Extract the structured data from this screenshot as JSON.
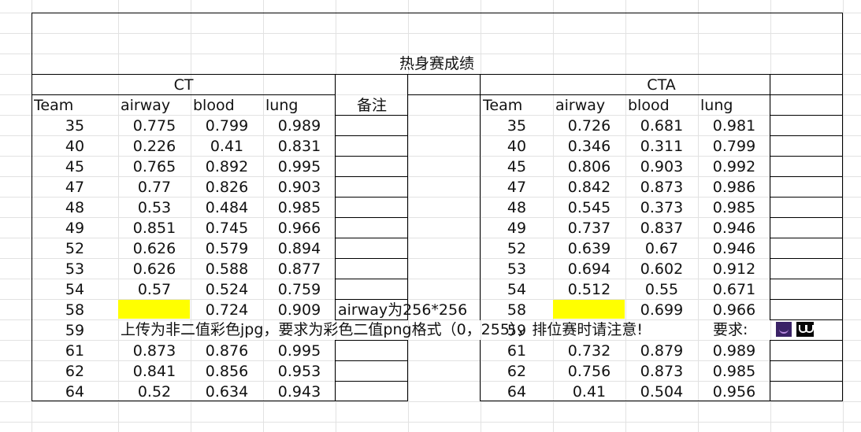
{
  "title": "热身赛成绩",
  "ct": {
    "group_label": "CT",
    "headers": [
      "Team",
      "airway",
      "blood",
      "lung",
      "备注"
    ],
    "rows": [
      [
        "35",
        "0.775",
        "0.799",
        "0.989",
        ""
      ],
      [
        "40",
        "0.226",
        "0.41",
        "0.831",
        ""
      ],
      [
        "45",
        "0.765",
        "0.892",
        "0.995",
        ""
      ],
      [
        "47",
        "0.77",
        "0.826",
        "0.903",
        ""
      ],
      [
        "48",
        "0.53",
        "0.484",
        "0.985",
        ""
      ],
      [
        "49",
        "0.851",
        "0.745",
        "0.966",
        ""
      ],
      [
        "52",
        "0.626",
        "0.579",
        "0.894",
        ""
      ],
      [
        "53",
        "0.626",
        "0.588",
        "0.877",
        ""
      ],
      [
        "54",
        "0.57",
        "0.524",
        "0.759",
        ""
      ],
      [
        "58",
        "",
        "0.724",
        "0.909",
        "airway为256*256"
      ],
      [
        "59",
        "",
        "",
        "",
        ""
      ],
      [
        "61",
        "0.873",
        "0.876",
        "0.995",
        ""
      ],
      [
        "62",
        "0.841",
        "0.856",
        "0.953",
        ""
      ],
      [
        "64",
        "0.52",
        "0.634",
        "0.943",
        ""
      ]
    ]
  },
  "cta": {
    "group_label": "CTA",
    "headers": [
      "Team",
      "airway",
      "blood",
      "lung",
      ""
    ],
    "rows": [
      [
        "35",
        "0.726",
        "0.681",
        "0.981",
        ""
      ],
      [
        "40",
        "0.346",
        "0.311",
        "0.799",
        ""
      ],
      [
        "45",
        "0.806",
        "0.903",
        "0.992",
        ""
      ],
      [
        "47",
        "0.842",
        "0.873",
        "0.986",
        ""
      ],
      [
        "48",
        "0.545",
        "0.373",
        "0.985",
        ""
      ],
      [
        "49",
        "0.737",
        "0.837",
        "0.946",
        ""
      ],
      [
        "52",
        "0.639",
        "0.67",
        "0.946",
        ""
      ],
      [
        "53",
        "0.694",
        "0.602",
        "0.912",
        ""
      ],
      [
        "54",
        "0.512",
        "0.55",
        "0.671",
        ""
      ],
      [
        "58",
        "",
        "0.699",
        "0.966",
        ""
      ],
      [
        "59",
        "",
        "",
        "",
        ""
      ],
      [
        "61",
        "0.732",
        "0.879",
        "0.989",
        ""
      ],
      [
        "62",
        "0.756",
        "0.873",
        "0.985",
        ""
      ],
      [
        "64",
        "0.41",
        "0.504",
        "0.956",
        ""
      ]
    ]
  },
  "notice_59": "上传为非二值彩色jpg，要求为彩色二值png格式（0，255），排位赛时请注意!",
  "requirement_label": "要求:",
  "highlight_color": "#ffff00",
  "embedded_images": [
    "purple-thumbnail-icon",
    "black-thumbnail-icon"
  ]
}
